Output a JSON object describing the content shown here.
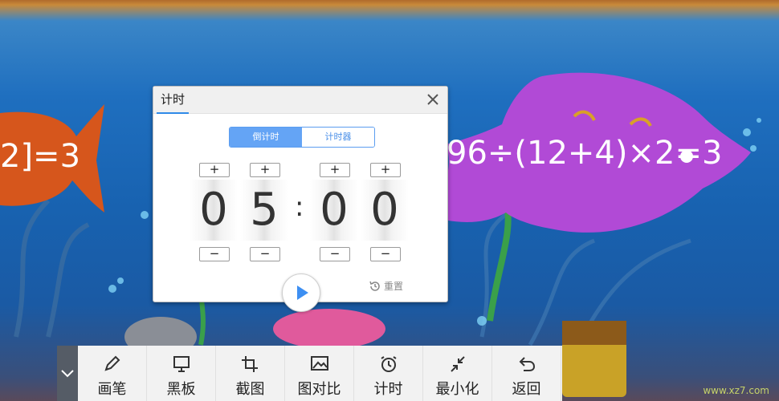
{
  "scene": {
    "equation_left": "2]=3",
    "equation_right": "96÷(12+4)×2=3"
  },
  "timer_window": {
    "tab_title": "计时",
    "mode_tabs": [
      {
        "label": "倒计时",
        "active": true
      },
      {
        "label": "计时器",
        "active": false
      }
    ],
    "digits": [
      "0",
      "5",
      "0",
      "0"
    ],
    "separator": ":",
    "plus_symbol": "+",
    "minus_symbol": "−",
    "reset_label": "重置"
  },
  "toolbar": {
    "items": [
      {
        "label": "画笔",
        "icon": "pen-icon"
      },
      {
        "label": "黑板",
        "icon": "monitor-icon"
      },
      {
        "label": "截图",
        "icon": "crop-icon"
      },
      {
        "label": "图对比",
        "icon": "image-compare-icon"
      },
      {
        "label": "计时",
        "icon": "alarm-clock-icon"
      },
      {
        "label": "最小化",
        "icon": "minimize-icon"
      },
      {
        "label": "返回",
        "icon": "undo-arrow-icon"
      }
    ]
  },
  "watermark": "www.xz7.com",
  "colors": {
    "accent": "#64a4f5",
    "tab_underline": "#2f8ae8",
    "fish_left": "#d6561c",
    "fish_right": "#b14ad6"
  }
}
